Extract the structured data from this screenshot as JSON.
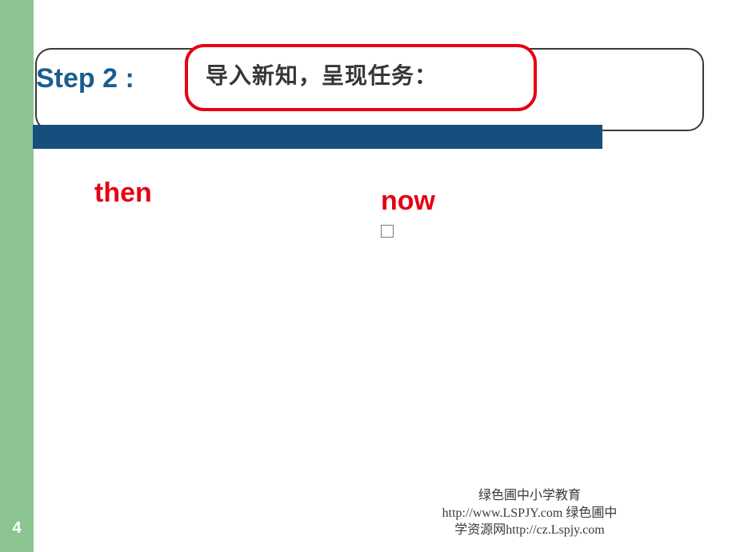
{
  "page": {
    "number": "4"
  },
  "header": {
    "step_label": "Step 2 :",
    "title": "导入新知，呈现任务："
  },
  "content": {
    "left_label": "then",
    "right_label": "now"
  },
  "footer": {
    "line1": "绿色圃中小学教育",
    "line2": "http://www.LSPJY.com    绿色圃中",
    "line3": "学资源网http://cz.Lspjy.com"
  }
}
